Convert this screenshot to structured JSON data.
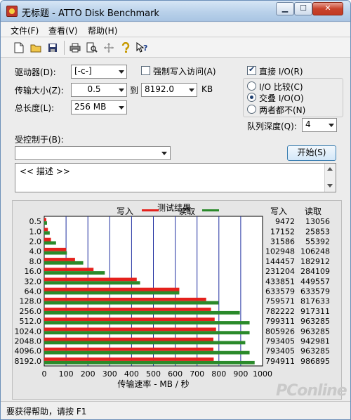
{
  "window": {
    "title": "无标题 - ATTO Disk Benchmark",
    "btn_min": "▁",
    "btn_max": "☐",
    "btn_close": "✕"
  },
  "menu": {
    "file": "文件(F)",
    "view": "查看(V)",
    "help": "帮助(H)"
  },
  "toolbar_icons": [
    "new-icon",
    "open-icon",
    "save-icon",
    "print-icon",
    "print-preview-icon",
    "move-icon",
    "help-icon",
    "context-help-icon"
  ],
  "settings": {
    "drive_label": "驱动器(D):",
    "drive_value": "[-c-]",
    "force_write_label": "强制写入访问(A)",
    "force_write_checked": false,
    "direct_io_label": "直接 I/O(R)",
    "direct_io_checked": true,
    "transfer_label": "传输大小(Z):",
    "transfer_from": "0.5",
    "to_label": "到",
    "transfer_to": "8192.0",
    "kb_label": "KB",
    "length_label": "总长度(L):",
    "length_value": "256 MB",
    "io_compare_label": "I/O 比较(C)",
    "overlap_io_label": "交叠 I/O(O)",
    "neither_label": "两者都不(N)",
    "io_mode_selected": "overlap",
    "queue_label": "队列深度(Q):",
    "queue_value": "4",
    "controlled_label": "受控制于(B):",
    "controlled_value": "",
    "start_label": "开始(S)",
    "desc_text": "<< 描述 >>"
  },
  "status_text": "要获得帮助，请按 F1",
  "watermark": "PConline",
  "chart_data": {
    "type": "bar",
    "title": "测试结果",
    "legend": [
      {
        "name": "写入",
        "color": "#e4211c"
      },
      {
        "name": "读取",
        "color": "#2a8a2a"
      }
    ],
    "xlabel": "传输速率 - MB / 秒",
    "xlim": [
      0,
      1000
    ],
    "xticks": [
      0,
      100,
      200,
      300,
      400,
      500,
      600,
      700,
      800,
      900,
      1000
    ],
    "categories": [
      "0.5",
      "1.0",
      "2.0",
      "4.0",
      "8.0",
      "16.0",
      "32.0",
      "64.0",
      "128.0",
      "256.0",
      "512.0",
      "1024.0",
      "2048.0",
      "4096.0",
      "8192.0"
    ],
    "column_headers": [
      "写入",
      "读取"
    ],
    "series": [
      {
        "name": "写入",
        "values": [
          9472,
          17152,
          31586,
          102948,
          144457,
          231204,
          433851,
          633579,
          759571,
          782222,
          799311,
          805926,
          793405,
          793405,
          794911
        ]
      },
      {
        "name": "读取",
        "values": [
          13056,
          25853,
          55392,
          106248,
          182912,
          284109,
          449557,
          633579,
          817633,
          917311,
          963285,
          963285,
          942981,
          963285,
          986895
        ]
      }
    ],
    "unit_note": "values in KB/s"
  }
}
